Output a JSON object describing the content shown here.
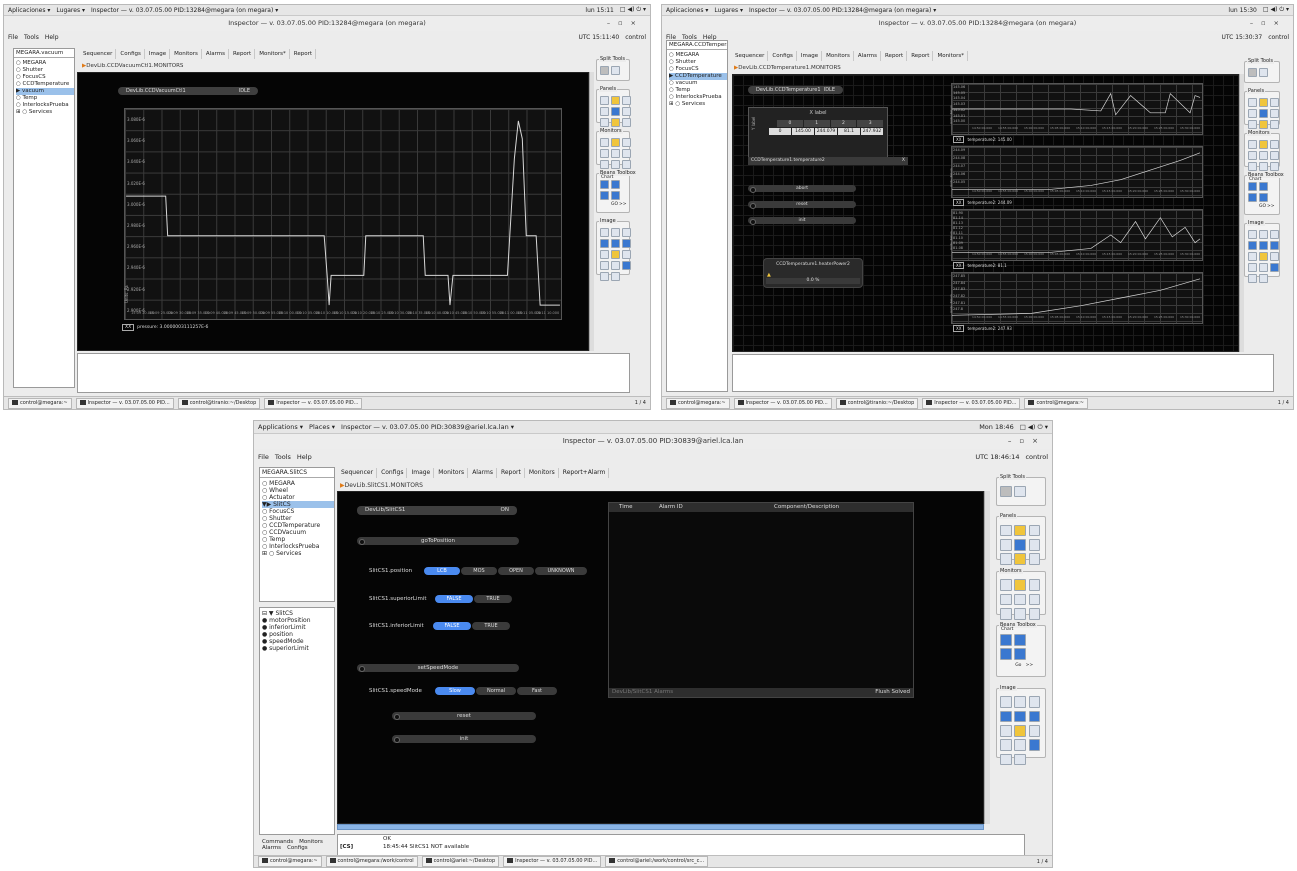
{
  "shot1": {
    "topbar": {
      "apps": "Aplicaciones ▾",
      "places": "Lugares ▾",
      "window": "Inspector — v. 03.07.05.00 PID:13284@megara (on megara) ▾",
      "clock": "lun 15:11"
    },
    "title": "Inspector — v. 03.07.05.00 PID:13284@megara (on megara)",
    "menu": {
      "file": "File",
      "tools": "Tools",
      "help": "Help",
      "utc": "UTC 15:11:40",
      "user": "control"
    },
    "selector": "MEGARA.vacuum",
    "tree": [
      "○ MEGARA",
      "  ○ Shutter",
      "  ○ FocusCS",
      "  ○ CCDTemperature",
      "  ▶ vacuum",
      "  ○ Temp",
      "  ○ InterlocksPrueba",
      "⊞ ○ Services"
    ],
    "tabs": [
      "Sequencer",
      "Configs",
      "Image",
      "Monitors",
      "Alarms",
      "Report",
      "Monitors*",
      "Report"
    ],
    "crumb": "DevLib.CCDVacuumCtl1.MONITORS",
    "dev_name": "DevLib.CCDVacuumCtl1",
    "dev_state": "IDLE",
    "yticks": [
      "3.080E-6",
      "3.060E-6",
      "3.040E-6",
      "3.020E-6",
      "3.000E-6",
      "2.980E-6",
      "2.960E-6",
      "2.940E-6",
      "2.920E-6",
      "2.900E-6"
    ],
    "xticks": [
      "15:09 20.000",
      "15:09 25.000",
      "15:09 30.000",
      "15:09 35.000",
      "15:09 40.000",
      "15:09 45.000",
      "15:09 50.000",
      "15:09 55.000",
      "15:10 00.000",
      "15:10 05.000",
      "15:10 10.000",
      "15:10 15.000",
      "15:10 20.000",
      "15:10 25.000",
      "15:10 30.000",
      "15:10 35.000",
      "15:10 40.000",
      "15:10 45.000",
      "15:10 50.000",
      "15:10 55.000",
      "15:11 00.000",
      "15:11 05.000",
      "15:11 10.000"
    ],
    "yaxis": "Units: Pa",
    "legend": "pressure: 3.0000003111257E-6",
    "legend_box": "XX",
    "right": {
      "split": "Split Tools",
      "panels": "Panels",
      "monitors": "Monitors",
      "beans": "Beans Toolbox",
      "chart": "Chart",
      "image": "Image",
      "go": "GO",
      "more": ">>"
    },
    "taskbar": [
      "control@megara:~",
      "Inspector — v. 03.07.05.00 PID...",
      "control@tiranio:~/Desktop",
      "Inspector — v. 03.07.05.00 PID..."
    ],
    "page": "1 / 4"
  },
  "shot2": {
    "topbar": {
      "apps": "Aplicaciones ▾",
      "places": "Lugares ▾",
      "window": "Inspector — v. 03.07.05.00 PID:13284@megara (on megara) ▾",
      "clock": "lun 15:30"
    },
    "title": "Inspector — v. 03.07.05.00 PID:13284@megara (on megara)",
    "menu": {
      "file": "File",
      "tools": "Tools",
      "help": "Help",
      "utc": "UTC 15:30:37",
      "user": "control"
    },
    "selector": "MEGARA.CCDTemperature",
    "tree": [
      "○ MEGARA",
      "  ○ Shutter",
      "  ○ FocusCS",
      "  ▶ CCDTemperature",
      "  ○ vacuum",
      "  ○ Temp",
      "  ○ InterlocksPrueba",
      "⊞ ○ Services"
    ],
    "tabs": [
      "Sequencer",
      "Configs",
      "Image",
      "Monitors",
      "Alarms",
      "Report",
      "Report",
      "Monitors*"
    ],
    "crumb": "DevLib.CCDTemperature1.MONITORS",
    "dev_name": "DevLib.CCDTemperature1",
    "dev_state": "IDLE",
    "table_title": "X label",
    "table_head": [
      "0",
      "1",
      "2",
      "3"
    ],
    "table_row": [
      "0",
      "145.00",
      "244.079",
      "81.1",
      "247.932"
    ],
    "ylabel_table": "Y label",
    "table_foot": "CCDTemperature1.temperature2",
    "table_foot_x": "X",
    "buttons": [
      "abort",
      "reset",
      "init"
    ],
    "power_title": "CCDTemperature1.heaterPower2",
    "power_val": "0.0",
    "power_unit": "%",
    "plots": [
      {
        "ticks": [
          "145.06",
          "145.05",
          "145.04",
          "145.03",
          "145.02",
          "145.01",
          "145.00"
        ],
        "legend": "temperature2: 145.00"
      },
      {
        "ticks": [
          "244.09",
          "244.08",
          "244.07",
          "244.06",
          "244.05"
        ],
        "legend": "temperature2: 244.09"
      },
      {
        "ticks": [
          "81.90",
          "81.14",
          "81.13",
          "81.12",
          "81.11",
          "81.10",
          "81.09",
          "81.08"
        ],
        "legend": "temperature2: 81.1"
      },
      {
        "ticks": [
          "247.85",
          "247.84",
          "247.83",
          "247.82",
          "247.81",
          "247.8"
        ],
        "legend": "temperature2: 247.93"
      }
    ],
    "plot_xticks": [
      "14:50 00.000",
      "14:55 00.000",
      "15:00 00.000",
      "15:05 00.000",
      "15:10 00.000",
      "15:15 00.000",
      "15:20 00.000",
      "15:25 00.000",
      "15:30 00.000"
    ],
    "plot_yaxis": "Units: Kelvin",
    "legend_box": "XX",
    "right": {
      "split": "Split Tools",
      "panels": "Panels",
      "monitors": "Monitors",
      "beans": "Beans Toolbox",
      "chart": "Chart",
      "image": "Image",
      "go": "GO",
      "more": ">>"
    },
    "taskbar": [
      "control@megara:~",
      "Inspector — v. 03.07.05.00 PID...",
      "control@tiranio:~/Desktop",
      "Inspector — v. 03.07.05.00 PID...",
      "control@megara:~"
    ],
    "page": "1 / 4"
  },
  "shot3": {
    "topbar": {
      "apps": "Applications ▾",
      "places": "Places ▾",
      "window": "Inspector — v. 03.07.05.00 PID:30839@ariel.lca.lan ▾",
      "clock": "Mon 18:46"
    },
    "title": "Inspector — v. 03.07.05.00 PID:30839@ariel.lca.lan",
    "menu": {
      "file": "File",
      "tools": "Tools",
      "help": "Help",
      "utc": "UTC 18:46:14",
      "user": "control"
    },
    "selector": "MEGARA.SlitCS",
    "tree": [
      "○ MEGARA",
      "  ○ Wheel",
      "  ○ Actuator",
      "  ▼▶ SlitCS",
      "  ○ FocusCS",
      "  ○ Shutter",
      "  ○ CCDTemperature",
      "  ○ CCDVacuum",
      "  ○ Temp",
      "  ○ InterlocksPrueba",
      "⊞ ○ Services"
    ],
    "tree2": [
      "⊟ ▼ SlitCS",
      "    ● motorPosition",
      "    ● inferiorLimit",
      "    ● position",
      "    ● speedMode",
      "    ● superiorLimit"
    ],
    "left_tabs": [
      "Commands",
      "Monitors",
      "Alarms",
      "Configs"
    ],
    "tabs": [
      "Sequencer",
      "Configs",
      "Image",
      "Monitors",
      "Alarms",
      "Report",
      "Monitors",
      "Report+Alarm"
    ],
    "crumb": "DevLib.SlitCS1.MONITORS",
    "dev_name": "DevLib/SlitCS1",
    "dev_state": "ON",
    "goto": "goToPosition",
    "position_label": "SlitCS1.position",
    "position_opts": [
      "LCB",
      "MOS",
      "OPEN",
      "UNKNOWN"
    ],
    "sup_label": "SlitCS1.superiorLimit",
    "sup_opts": [
      "FALSE",
      "TRUE"
    ],
    "inf_label": "SlitCS1.inferiorLimit",
    "inf_opts": [
      "FALSE",
      "TRUE"
    ],
    "setspeed": "setSpeedMode",
    "speed_label": "SlitCS1.speedMode",
    "speed_opts": [
      "Slow",
      "Normal",
      "Fast"
    ],
    "reset": "reset",
    "init": "init",
    "alarm_head": [
      "Time",
      "Alarm ID",
      "Component/Description"
    ],
    "alarm_foot": "DevLib/SlitCS1 Alarms",
    "alarm_flush": "Flush Solved",
    "console_ok": "OK",
    "console_tag": "[CS]",
    "console_msg": "18:45:44 SlitCS1 NOT available",
    "right": {
      "split": "Split Tools",
      "panels": "Panels",
      "monitors": "Monitors",
      "beans": "Beans Toolbox",
      "chart": "Chart",
      "image": "Image",
      "go": "Go",
      "more": ">>"
    },
    "taskbar": [
      "control@megara:~",
      "control@megara:/work/control",
      "control@ariel:~/Desktop",
      "Inspector — v. 03.07.05.00 PID...",
      "control@ariel:/work/control/src_c..."
    ],
    "page": "1 / 4"
  },
  "colors": {
    "accent": "#4a8af0",
    "panel": "#050505",
    "plotline": "#d8d8d8",
    "selection": "#9bc1ea"
  }
}
